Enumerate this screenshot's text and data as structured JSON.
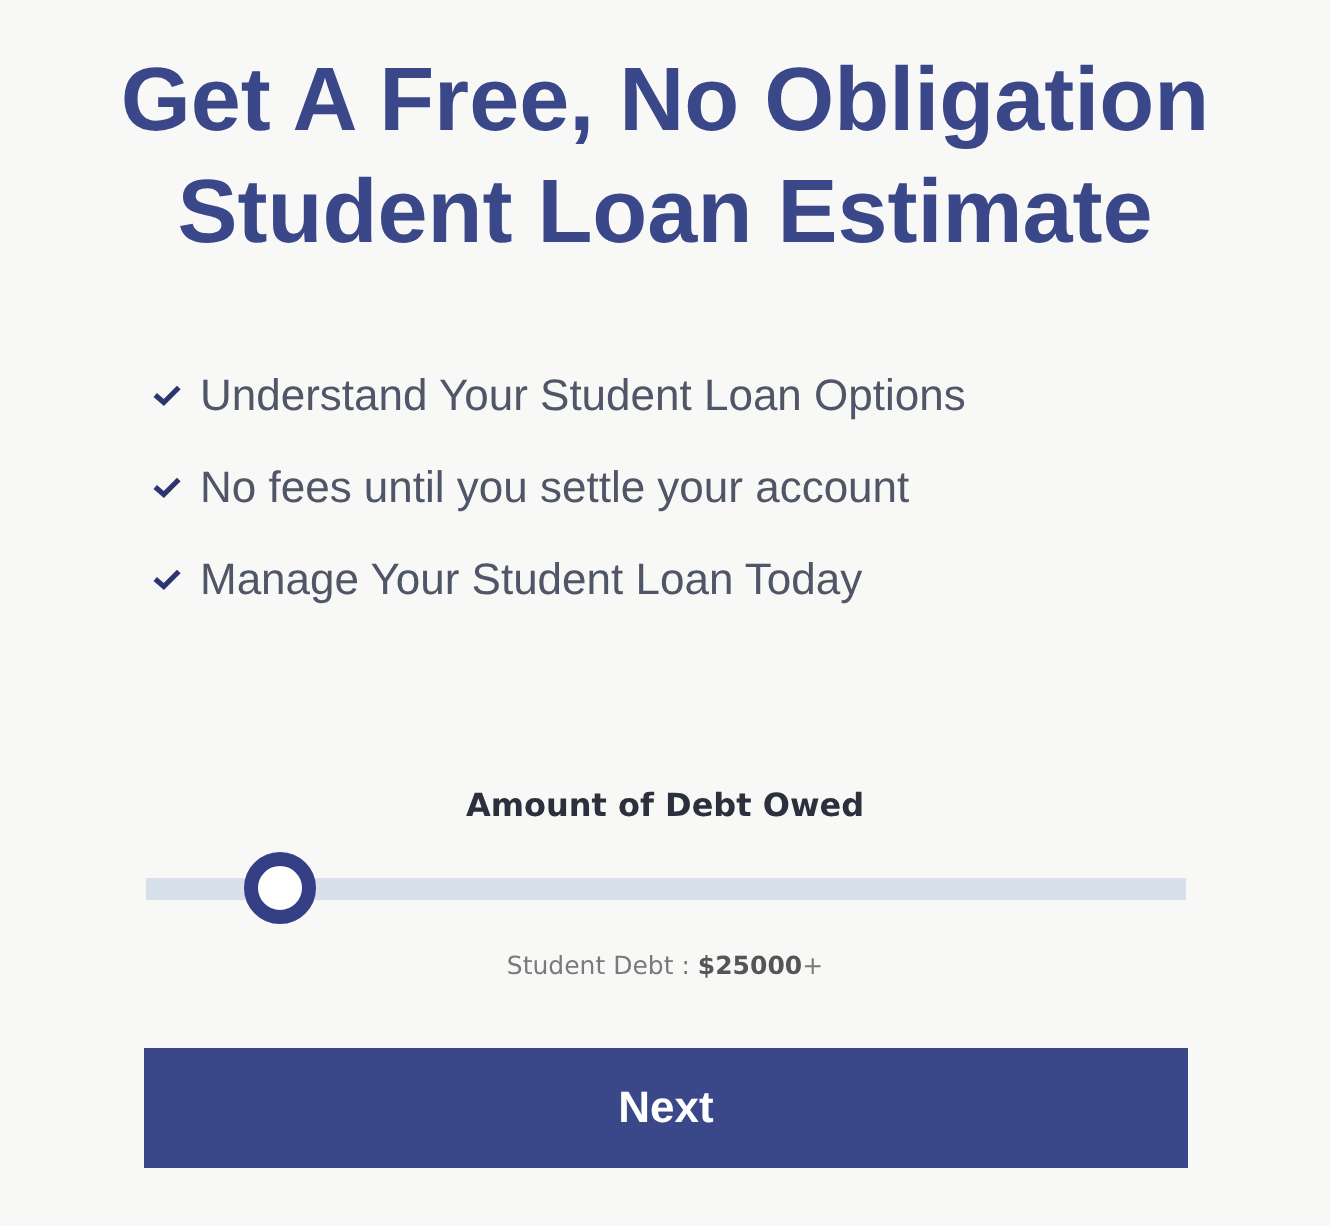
{
  "title": "Get A Free, No Obligation Student Loan Estimate",
  "benefits": [
    "Understand Your Student Loan Options",
    "No fees until you settle your account",
    "Manage Your Student Loan Today"
  ],
  "slider": {
    "label": "Amount of Debt Owed",
    "level": 0.13,
    "reading": "Student Debt : **$25000**+"
  },
  "button": "Next"
}
